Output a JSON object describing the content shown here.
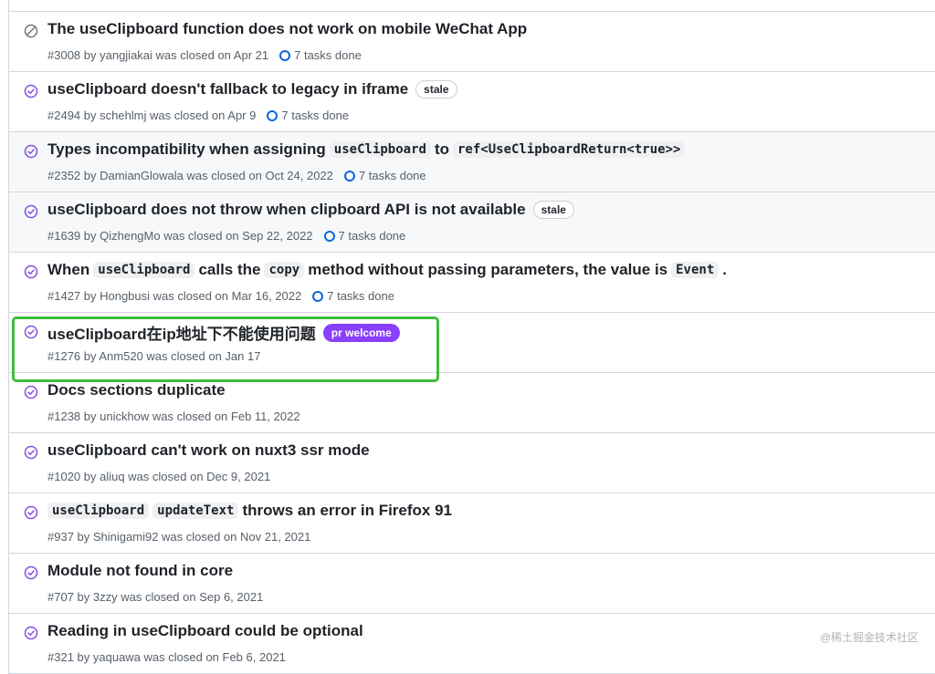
{
  "issues": [
    {
      "title_parts": [
        {
          "t": "text",
          "v": "The useClipboard function does not work on mobile WeChat App"
        }
      ],
      "meta": "#3008 by yangjiakai was closed on Apr 21",
      "tasks": "7 tasks done",
      "icon": "not-planned-icon"
    },
    {
      "title_parts": [
        {
          "t": "text",
          "v": "useClipboard doesn't fallback to legacy in iframe"
        }
      ],
      "label": "stale",
      "label_type": "stale",
      "meta": "#2494 by schehlmj was closed on Apr 9",
      "tasks": "7 tasks done",
      "icon": "completed-icon"
    },
    {
      "title_parts": [
        {
          "t": "text",
          "v": "Types incompatibility when assigning"
        },
        {
          "t": "code",
          "v": "useClipboard"
        },
        {
          "t": "text",
          "v": "to"
        },
        {
          "t": "code",
          "v": "ref<UseClipboardReturn<true>>"
        }
      ],
      "meta": "#2352 by DamianGlowala was closed on Oct 24, 2022",
      "tasks": "7 tasks done",
      "icon": "completed-icon"
    },
    {
      "title_parts": [
        {
          "t": "text",
          "v": "useClipboard does not throw when clipboard API is not available"
        }
      ],
      "label": "stale",
      "label_type": "stale",
      "meta": "#1639 by QizhengMo was closed on Sep 22, 2022",
      "tasks": "7 tasks done",
      "icon": "completed-icon"
    },
    {
      "title_parts": [
        {
          "t": "text",
          "v": "When"
        },
        {
          "t": "code",
          "v": "useClipboard"
        },
        {
          "t": "text",
          "v": "calls the"
        },
        {
          "t": "code",
          "v": "copy"
        },
        {
          "t": "text",
          "v": "method without passing parameters, the value is"
        },
        {
          "t": "code",
          "v": "Event"
        },
        {
          "t": "text",
          "v": "."
        }
      ],
      "meta": "#1427 by Hongbusi was closed on Mar 16, 2022",
      "tasks": "7 tasks done",
      "icon": "completed-icon"
    },
    {
      "title_parts": [
        {
          "t": "text",
          "v": "useClipboard在ip地址下不能使用问题"
        }
      ],
      "label": "pr welcome",
      "label_type": "pr",
      "meta": "#1276 by Anm520 was closed on Jan 17",
      "icon": "completed-icon"
    },
    {
      "title_parts": [
        {
          "t": "text",
          "v": "Docs sections duplicate"
        }
      ],
      "meta": "#1238 by unickhow was closed on Feb 11, 2022",
      "icon": "completed-icon"
    },
    {
      "title_parts": [
        {
          "t": "text",
          "v": "useClipboard can't work on nuxt3 ssr mode"
        }
      ],
      "meta": "#1020 by aliuq was closed on Dec 9, 2021",
      "icon": "completed-icon"
    },
    {
      "title_parts": [
        {
          "t": "code",
          "v": "useClipboard"
        },
        {
          "t": "code",
          "v": "updateText"
        },
        {
          "t": "text",
          "v": "throws an error in Firefox 91"
        }
      ],
      "meta": "#937 by Shinigami92 was closed on Nov 21, 2021",
      "icon": "completed-icon"
    },
    {
      "title_parts": [
        {
          "t": "text",
          "v": "Module not found in core"
        }
      ],
      "meta": "#707 by 3zzy was closed on Sep 6, 2021",
      "icon": "completed-icon"
    },
    {
      "title_parts": [
        {
          "t": "text",
          "v": "Reading in useClipboard could be optional"
        }
      ],
      "meta": "#321 by yaquawa was closed on Feb 6, 2021",
      "icon": "completed-icon"
    }
  ],
  "alt_rows": [
    2,
    3
  ],
  "highlighted_index": 5,
  "watermark": "@稀土掘金技术社区",
  "colors": {
    "completed": "#8250df",
    "not_planned": "#6e7781",
    "pr_label": "#8a3ffc",
    "highlight": "#3fbe3a",
    "tasks_ring": "#0969da"
  }
}
